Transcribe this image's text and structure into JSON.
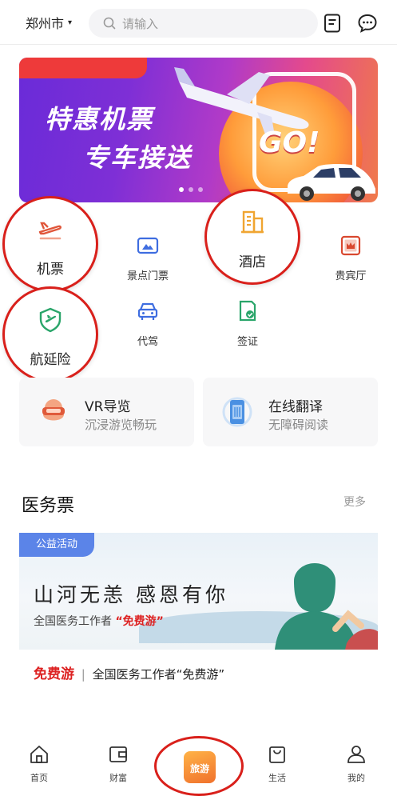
{
  "header": {
    "city": "郑州市",
    "city_caret": "▾",
    "search_placeholder": "请输入"
  },
  "banner": {
    "line1": "特惠机票",
    "line2": "专车接送",
    "go_text": "GO!"
  },
  "grid": {
    "row1": [
      {
        "label": "机票"
      },
      {
        "label": "景点门票"
      },
      {
        "label": "酒店"
      },
      {
        "label": "贵宾厅"
      }
    ],
    "row2": [
      {
        "label": "航延险"
      },
      {
        "label": "代驾"
      },
      {
        "label": "签证"
      }
    ]
  },
  "highlights": {
    "flight": "机票",
    "hotel": "酒店",
    "delay_insurance": "航延险"
  },
  "cards": [
    {
      "title": "VR导览",
      "subtitle": "沉浸游览畅玩"
    },
    {
      "title": "在线翻译",
      "subtitle": "无障碍阅读"
    }
  ],
  "section": {
    "title": "医务票",
    "more": "更多",
    "promo_tag": "公益活动",
    "slogan": "山河无恙 感恩有你",
    "promo_sub_prefix": "全国医务工作者",
    "promo_sub_highlight": "“免费游”",
    "caption_red": "免费游",
    "caption_bar": "|",
    "caption_text": "全国医务工作者“免费游”"
  },
  "tabbar": {
    "home": "首页",
    "wealth": "财富",
    "travel": "旅游",
    "life": "生活",
    "mine": "我的"
  }
}
